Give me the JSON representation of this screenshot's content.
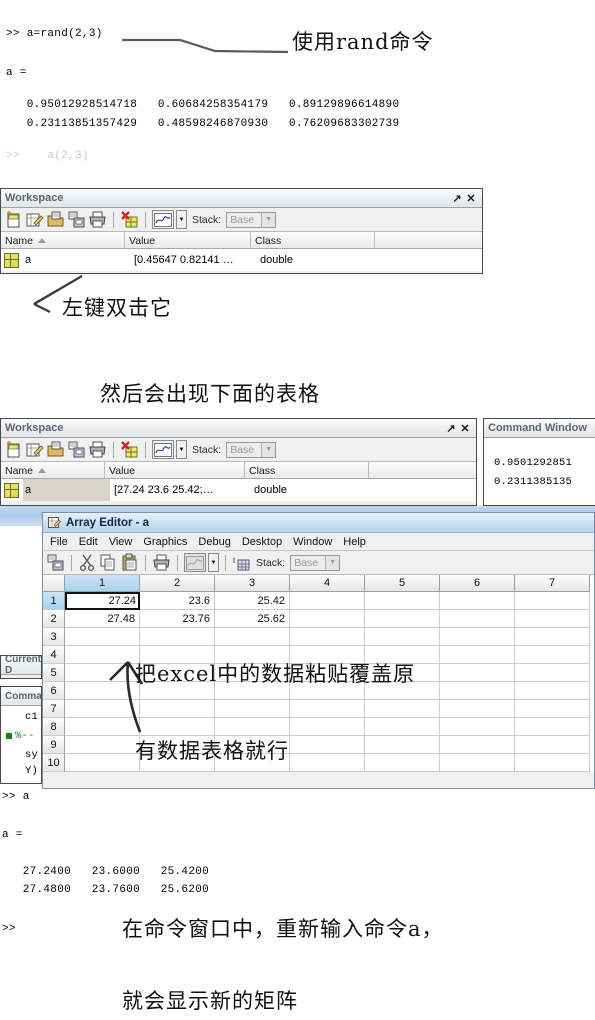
{
  "console_top": {
    "prompt_line": ">> a=rand(2,3)",
    "result_label": "a =",
    "matrix_rows": [
      "   0.95012928514718   0.60684258354179   0.89129896614890",
      "   0.23113851357429   0.48598246870930   0.76209683302739"
    ],
    "faded_line": ">>    a(2,3)"
  },
  "annotations": {
    "use_rand": "使用rand命令",
    "double_click": "左键双击它",
    "table_appears": "然后会出现下面的表格",
    "paste_excel": "把excel中的数据粘贴覆盖原",
    "any_table": "有数据表格就行",
    "retype_cmd": "在命令窗口中，重新输入命令a，",
    "show_matrix": "就会显示新的矩阵"
  },
  "workspace_top": {
    "title": "Workspace",
    "undock_label": "↗",
    "close_label": "✕",
    "toolbar": {
      "stack_label": "Stack:",
      "stack_value": "Base",
      "icons": [
        "new-variable-icon",
        "open-variable-icon",
        "import-data-icon",
        "save-workspace-icon",
        "print-icon",
        "delete-variable-icon",
        "plot-icon",
        "plot-dropdown-icon"
      ]
    },
    "columns": [
      "Name",
      "Value",
      "Class"
    ],
    "rows": [
      {
        "name": "a",
        "value": "[0.45647 0.82141 …",
        "class": "double"
      }
    ]
  },
  "workspace_bottom": {
    "title": "Workspace",
    "undock_label": "↗",
    "close_label": "✕",
    "toolbar": {
      "stack_label": "Stack:",
      "stack_value": "Base"
    },
    "columns": [
      "Name",
      "Value",
      "Class"
    ],
    "rows": [
      {
        "name": "a",
        "value": "[27.24 23.6 25.42;…",
        "class": "double"
      }
    ]
  },
  "command_window_panel": {
    "title": "Command Window",
    "lines": [
      "0.9501292851",
      "0.2311385135"
    ]
  },
  "current_directory_panel": {
    "title": "Current D"
  },
  "command_history_panel": {
    "title": "Comman",
    "lines": [
      "c1",
      "%--",
      "sy",
      "Y)"
    ]
  },
  "array_editor": {
    "title": "Array Editor - a",
    "menus": [
      "File",
      "Edit",
      "View",
      "Graphics",
      "Debug",
      "Desktop",
      "Window",
      "Help"
    ],
    "toolbar": {
      "stack_label": "Stack:",
      "stack_value": "Base",
      "icons": [
        "save-icon",
        "cut-icon",
        "copy-icon",
        "paste-icon",
        "print-icon",
        "plot-icon",
        "plot-dropdown-icon",
        "transpose-icon"
      ]
    },
    "column_headers": [
      "1",
      "2",
      "3",
      "4",
      "5",
      "6",
      "7"
    ],
    "row_headers": [
      "1",
      "2",
      "3",
      "4",
      "5",
      "6",
      "7",
      "8",
      "9",
      "10"
    ],
    "cells": [
      [
        "27.24",
        "23.6",
        "25.42",
        "",
        "",
        "",
        ""
      ],
      [
        "27.48",
        "23.76",
        "25.62",
        "",
        "",
        "",
        ""
      ],
      [
        "",
        "",
        "",
        "",
        "",
        "",
        ""
      ],
      [
        "",
        "",
        "",
        "",
        "",
        "",
        ""
      ],
      [
        "",
        "",
        "",
        "",
        "",
        "",
        ""
      ],
      [
        "",
        "",
        "",
        "",
        "",
        "",
        ""
      ],
      [
        "",
        "",
        "",
        "",
        "",
        "",
        ""
      ],
      [
        "",
        "",
        "",
        "",
        "",
        "",
        ""
      ],
      [
        "",
        "",
        "",
        "",
        "",
        "",
        ""
      ],
      [
        "",
        "",
        "",
        "",
        "",
        "",
        ""
      ]
    ],
    "selected_cell": {
      "row": 0,
      "col": 0
    }
  },
  "console_bottom": {
    "prompt_line": ">> a",
    "result_label": "a =",
    "matrix_rows": [
      "   27.2400   23.6000   25.4200",
      "   27.4800   23.7600   25.6200"
    ],
    "final_prompt": ">>"
  },
  "colors": {
    "title_text": "#5a6672",
    "selection_blue": "#a8d2f0",
    "delete_red": "#cc2222",
    "plot_blue": "#2b3fa8",
    "history_green": "#0a8a0a",
    "var_icon_yellow": "#d6d655"
  }
}
